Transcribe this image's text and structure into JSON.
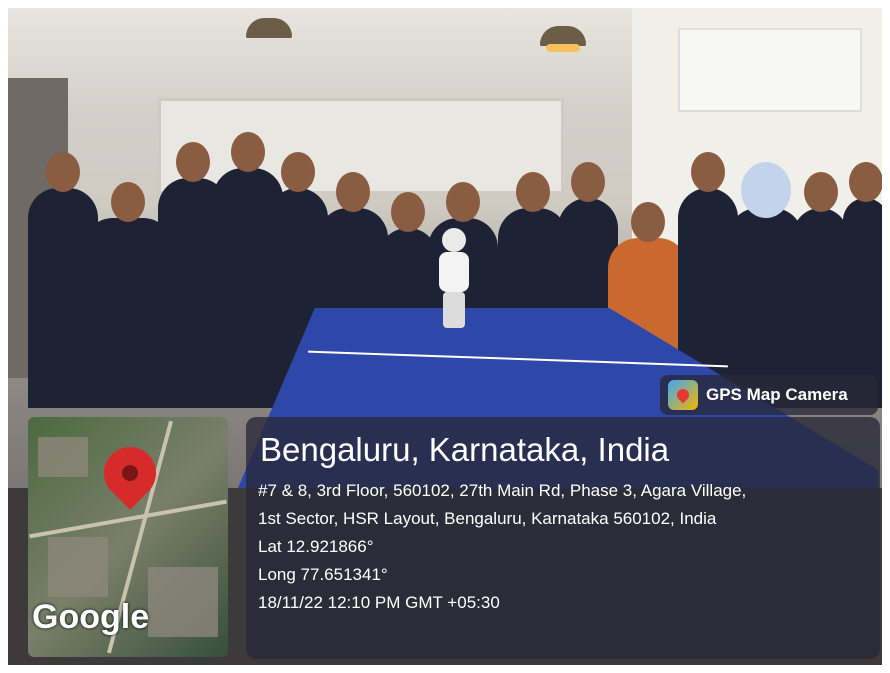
{
  "badge": {
    "label": "GPS Map Camera",
    "icon": "gps-map-camera-icon"
  },
  "map": {
    "attribution": "Google",
    "pin_icon": "map-pin-icon"
  },
  "location": {
    "title": "Bengaluru, Karnataka, India",
    "address_line1": "#7 & 8, 3rd Floor, 560102, 27th Main Rd, Phase 3, Agara Village,",
    "address_line2": "1st Sector, HSR Layout, Bengaluru, Karnataka 560102, India",
    "lat": "Lat 12.921866°",
    "long": "Long 77.651341°",
    "datetime": "18/11/22 12:10 PM GMT +05:30"
  },
  "colors": {
    "panel_bg": "#282837",
    "table_blue": "#2d48a9",
    "pin_red": "#d72b2b"
  }
}
